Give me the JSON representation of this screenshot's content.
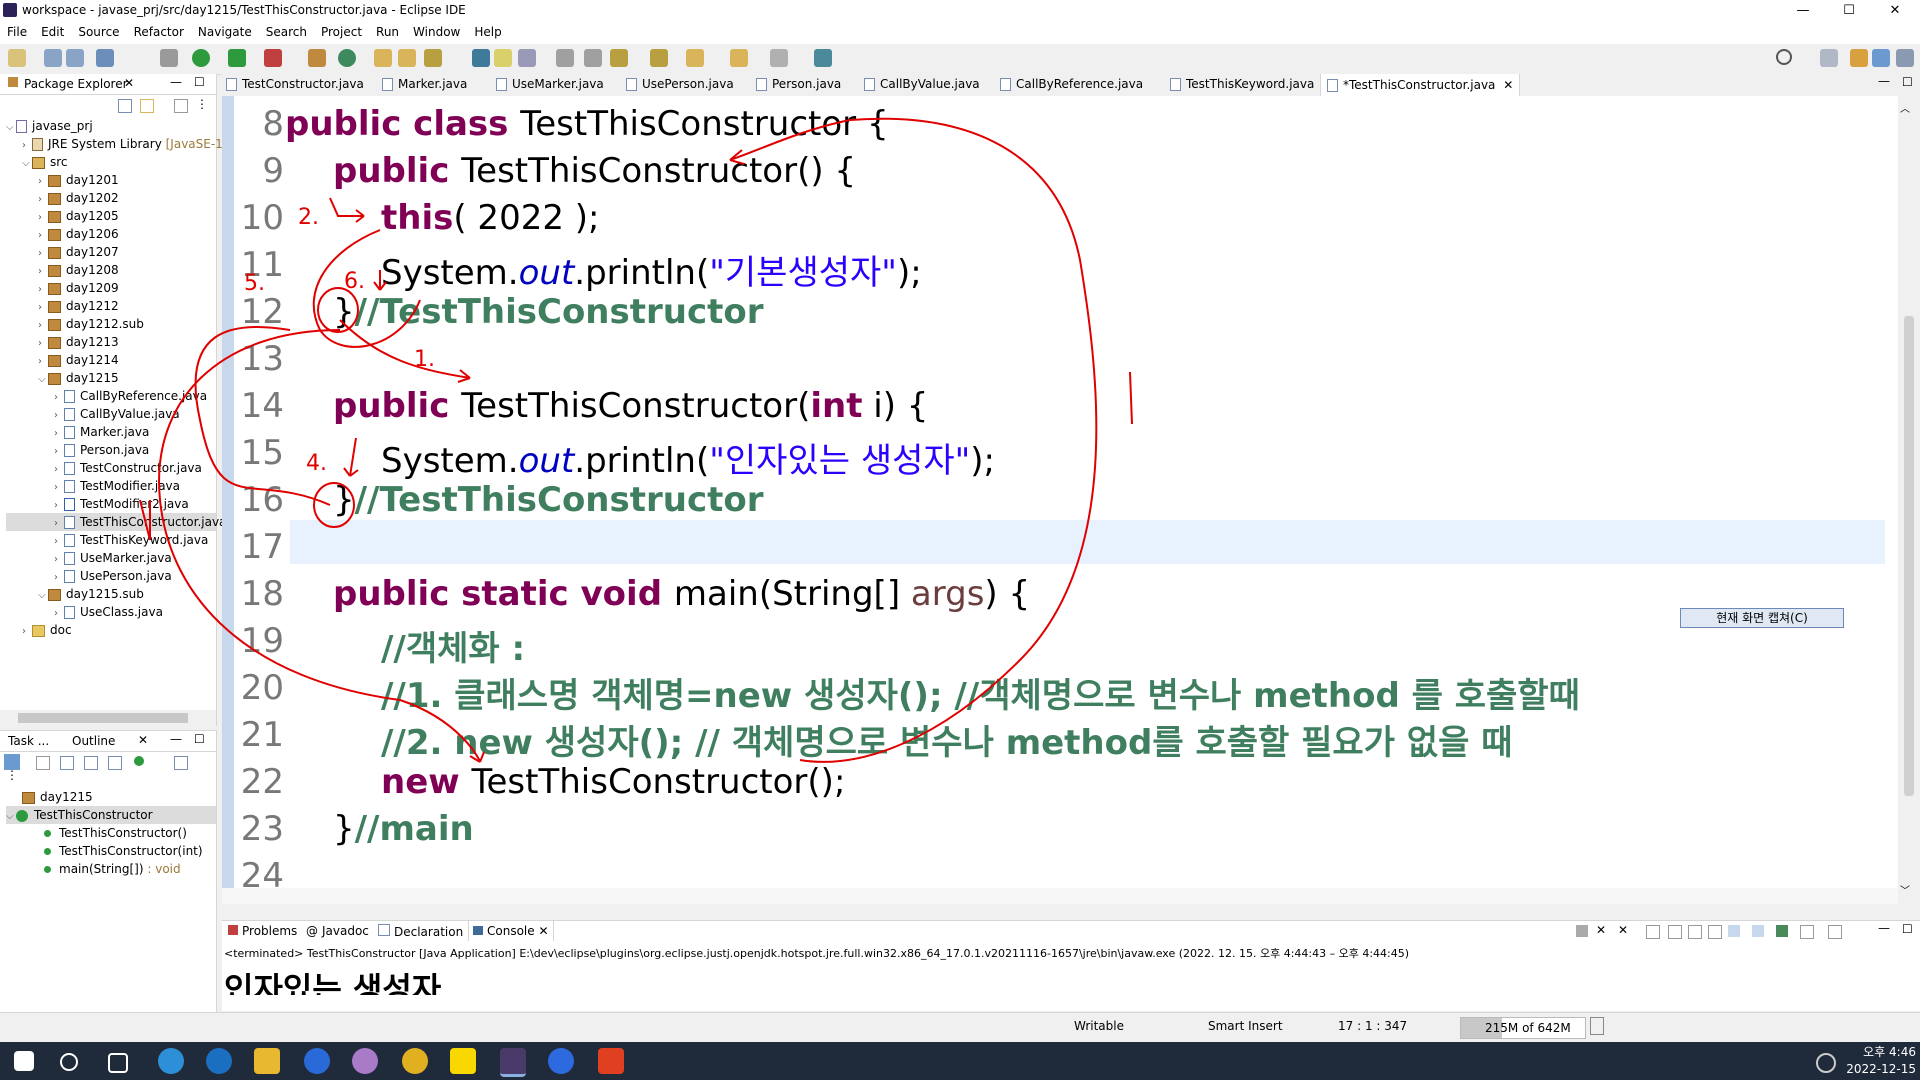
{
  "window": {
    "title": "workspace - javase_prj/src/day1215/TestThisConstructor.java - Eclipse IDE",
    "minimize": "—",
    "maximize": "☐",
    "close": "✕"
  },
  "menu": [
    "File",
    "Edit",
    "Source",
    "Refactor",
    "Navigate",
    "Search",
    "Project",
    "Run",
    "Window",
    "Help"
  ],
  "package_explorer": {
    "title": "Package Explorer",
    "project": "javase_prj",
    "jre": "JRE System Library",
    "jre_suffix": "[JavaSE-1",
    "src": "src",
    "packages": [
      "day1201",
      "day1202",
      "day1205",
      "day1206",
      "day1207",
      "day1208",
      "day1209",
      "day1212",
      "day1212.sub",
      "day1213",
      "day1214"
    ],
    "open_package": "day1215",
    "files": [
      "CallByReference.java",
      "CallByValue.java",
      "Marker.java",
      "Person.java",
      "TestConstructor.java",
      "TestModifier.java",
      "TestModifier2.java",
      "TestThisConstructor.java",
      "TestThisKeyword.java",
      "UseMarker.java",
      "UsePerson.java"
    ],
    "sub_package": "day1215.sub",
    "sub_files": [
      "UseClass.java"
    ],
    "doc": "doc"
  },
  "outline": {
    "tab_task": "Task ...",
    "tab_outline": "Outline",
    "package": "day1215",
    "class": "TestThisConstructor",
    "members": [
      {
        "name": "TestThisConstructor()",
        "type": ""
      },
      {
        "name": "TestThisConstructor(int)",
        "type": ""
      },
      {
        "name": "main(String[])",
        "type": ": void"
      }
    ]
  },
  "editor_tabs": [
    "TestConstructor.java",
    "Marker.java",
    "UseMarker.java",
    "UsePerson.java",
    "Person.java",
    "CallByValue.java",
    "CallByReference.java",
    "TestThisKeyword.java",
    "*TestThisConstructor.java"
  ],
  "code": {
    "line_numbers": [
      "8",
      "9",
      "10",
      "11",
      "12",
      "13",
      "14",
      "15",
      "16",
      "17",
      "18",
      "19",
      "20",
      "21",
      "22",
      "23",
      "24"
    ],
    "l8_kw": "public class ",
    "l8_rest": "TestThisConstructor {",
    "l9_kw": "public ",
    "l9_rest": "TestThisConstructor() {",
    "l10_kw": "this",
    "l10_rest": "( 2022 );",
    "l11_a": "System.",
    "l11_b": "out",
    "l11_c": ".println(",
    "l11_str": "\"기본생성자\"",
    "l11_d": ");",
    "l12_a": "}",
    "l12_cm": "//TestThisConstructor",
    "l14_kw": "public ",
    "l14_a": "TestThisConstructor(",
    "l14_kw2": "int",
    "l14_b": " i) {",
    "l15_a": "System.",
    "l15_b": "out",
    "l15_c": ".println(",
    "l15_str": "\"인자있는 생성자\"",
    "l15_d": ");",
    "l16_a": "}",
    "l16_cm": "//TestThisConstructor",
    "l18_kw": "public static void ",
    "l18_a": "main(String[] ",
    "l18_args": "args",
    "l18_b": ") {",
    "l19_cm": "//객체화 :",
    "l20_cm": "//1. 클래스명 객체명=new 생성자(); //객체명으로 변수나 method 를 호출할때",
    "l21_cm": "//2. new 생성자(); // 객체명으로 변수나 method를 호출할 필요가 없을 때",
    "l22_kw": "new ",
    "l22_a": "TestThisConstructor();",
    "l23_a": "}",
    "l23_cm": "//main"
  },
  "capture_button": "현재 화면 캡쳐(C)",
  "annotations": [
    "2.",
    "5.",
    "6.",
    "1.",
    "4.",
    "1."
  ],
  "console": {
    "tabs": [
      "Problems",
      "Javadoc",
      "Declaration",
      "Console"
    ],
    "header": "<terminated> TestThisConstructor [Java Application] E:\\dev\\eclipse\\plugins\\org.eclipse.justj.openjdk.hotspot.jre.full.win32.x86_64_17.0.1.v20211116-1657\\jre\\bin\\javaw.exe  (2022. 12. 15. 오후 4:44:43 – 오후 4:44:45)",
    "output": "인자있는 생성자"
  },
  "status": {
    "writable": "Writable",
    "insert": "Smart Insert",
    "position": "17 : 1 : 347",
    "memory": "215M of 642M"
  },
  "taskbar": {
    "time": "오후 4:46",
    "date": "2022-12-15"
  },
  "colors": {
    "keyword": "#7f0055",
    "comment": "#3f7f5f",
    "string": "#2a00ff",
    "field": "#0000c0",
    "ink": "#e00000"
  }
}
